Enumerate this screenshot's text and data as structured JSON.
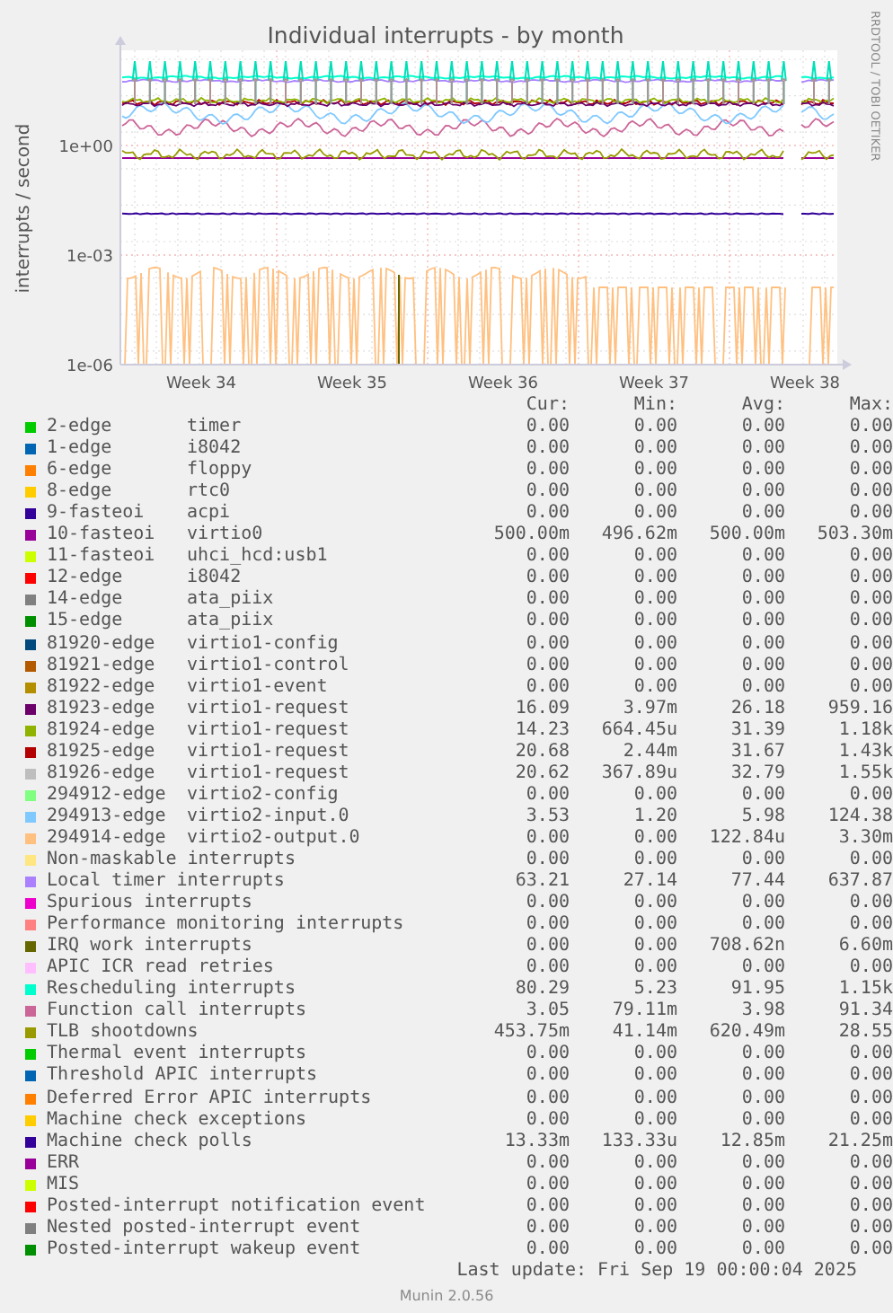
{
  "chart": {
    "title": "Individual interrupts - by month",
    "ylabel": "interrupts / second",
    "yticks": [
      "1e+00",
      "1e-03",
      "1e-06"
    ],
    "xticks": [
      "Week 34",
      "Week 35",
      "Week 36",
      "Week 37",
      "Week 38"
    ],
    "credit": "RRDTOOL / TOBI OETIKER"
  },
  "legend": {
    "columns": [
      "Cur:",
      "Min:",
      "Avg:",
      "Max:"
    ],
    "rows": [
      {
        "name": "2-edge",
        "label": "timer",
        "color": "#00cc00",
        "values": [
          "0.00",
          "0.00",
          "0.00",
          "0.00"
        ]
      },
      {
        "name": "1-edge",
        "label": "i8042",
        "color": "#0066b3",
        "values": [
          "0.00",
          "0.00",
          "0.00",
          "0.00"
        ]
      },
      {
        "name": "6-edge",
        "label": "floppy",
        "color": "#ff8000",
        "values": [
          "0.00",
          "0.00",
          "0.00",
          "0.00"
        ]
      },
      {
        "name": "8-edge",
        "label": "rtc0",
        "color": "#ffcc00",
        "values": [
          "0.00",
          "0.00",
          "0.00",
          "0.00"
        ]
      },
      {
        "name": "9-fasteoi",
        "label": "acpi",
        "color": "#330099",
        "values": [
          "0.00",
          "0.00",
          "0.00",
          "0.00"
        ]
      },
      {
        "name": "10-fasteoi",
        "label": "virtio0",
        "color": "#990099",
        "values": [
          "500.00m",
          "496.62m",
          "500.00m",
          "503.30m"
        ]
      },
      {
        "name": "11-fasteoi",
        "label": "uhci_hcd:usb1",
        "color": "#ccff00",
        "values": [
          "0.00",
          "0.00",
          "0.00",
          "0.00"
        ]
      },
      {
        "name": "12-edge",
        "label": "i8042",
        "color": "#ff0000",
        "values": [
          "0.00",
          "0.00",
          "0.00",
          "0.00"
        ]
      },
      {
        "name": "14-edge",
        "label": "ata_piix",
        "color": "#808080",
        "values": [
          "0.00",
          "0.00",
          "0.00",
          "0.00"
        ]
      },
      {
        "name": "15-edge",
        "label": "ata_piix",
        "color": "#008f00",
        "values": [
          "0.00",
          "0.00",
          "0.00",
          "0.00"
        ]
      },
      {
        "name": "81920-edge",
        "label": "virtio1-config",
        "color": "#00487d",
        "values": [
          "0.00",
          "0.00",
          "0.00",
          "0.00"
        ]
      },
      {
        "name": "81921-edge",
        "label": "virtio1-control",
        "color": "#b35a00",
        "values": [
          "0.00",
          "0.00",
          "0.00",
          "0.00"
        ]
      },
      {
        "name": "81922-edge",
        "label": "virtio1-event",
        "color": "#b38f00",
        "values": [
          "0.00",
          "0.00",
          "0.00",
          "0.00"
        ]
      },
      {
        "name": "81923-edge",
        "label": "virtio1-request",
        "color": "#6b006b",
        "values": [
          "16.09",
          "3.97m",
          "26.18",
          "959.16"
        ]
      },
      {
        "name": "81924-edge",
        "label": "virtio1-request",
        "color": "#8fb300",
        "values": [
          "14.23",
          "664.45u",
          "31.39",
          "1.18k"
        ]
      },
      {
        "name": "81925-edge",
        "label": "virtio1-request",
        "color": "#b30000",
        "values": [
          "20.68",
          "2.44m",
          "31.67",
          "1.43k"
        ]
      },
      {
        "name": "81926-edge",
        "label": "virtio1-request",
        "color": "#bebebe",
        "values": [
          "20.62",
          "367.89u",
          "32.79",
          "1.55k"
        ]
      },
      {
        "name": "294912-edge",
        "label": "virtio2-config",
        "color": "#80ff80",
        "values": [
          "0.00",
          "0.00",
          "0.00",
          "0.00"
        ]
      },
      {
        "name": "294913-edge",
        "label": "virtio2-input.0",
        "color": "#80c9ff",
        "values": [
          "3.53",
          "1.20",
          "5.98",
          "124.38"
        ]
      },
      {
        "name": "294914-edge",
        "label": "virtio2-output.0",
        "color": "#ffc080",
        "values": [
          "0.00",
          "0.00",
          "122.84u",
          "3.30m"
        ]
      },
      {
        "name": "Non-maskable interrupts",
        "color": "#ffe680",
        "values": [
          "0.00",
          "0.00",
          "0.00",
          "0.00"
        ]
      },
      {
        "name": "Local timer interrupts",
        "color": "#aa80ff",
        "values": [
          "63.21",
          "27.14",
          "77.44",
          "637.87"
        ]
      },
      {
        "name": "Spurious interrupts",
        "color": "#ee00cc",
        "values": [
          "0.00",
          "0.00",
          "0.00",
          "0.00"
        ]
      },
      {
        "name": "Performance monitoring interrupts",
        "color": "#ff8080",
        "values": [
          "0.00",
          "0.00",
          "0.00",
          "0.00"
        ]
      },
      {
        "name": "IRQ work interrupts",
        "color": "#666600",
        "values": [
          "0.00",
          "0.00",
          "708.62n",
          "6.60m"
        ]
      },
      {
        "name": "APIC ICR read retries",
        "color": "#ffbfff",
        "values": [
          "0.00",
          "0.00",
          "0.00",
          "0.00"
        ]
      },
      {
        "name": "Rescheduling interrupts",
        "color": "#00ffcc",
        "values": [
          "80.29",
          "5.23",
          "91.95",
          "1.15k"
        ]
      },
      {
        "name": "Function call interrupts",
        "color": "#cc6699",
        "values": [
          "3.05",
          "79.11m",
          "3.98",
          "91.34"
        ]
      },
      {
        "name": "TLB shootdowns",
        "color": "#999900",
        "values": [
          "453.75m",
          "41.14m",
          "620.49m",
          "28.55"
        ]
      },
      {
        "name": "Thermal event interrupts",
        "color": "#00cc00",
        "values": [
          "0.00",
          "0.00",
          "0.00",
          "0.00"
        ]
      },
      {
        "name": "Threshold APIC interrupts",
        "color": "#0066b3",
        "values": [
          "0.00",
          "0.00",
          "0.00",
          "0.00"
        ]
      },
      {
        "name": "Deferred Error APIC interrupts",
        "color": "#ff8000",
        "values": [
          "0.00",
          "0.00",
          "0.00",
          "0.00"
        ]
      },
      {
        "name": "Machine check exceptions",
        "color": "#ffcc00",
        "values": [
          "0.00",
          "0.00",
          "0.00",
          "0.00"
        ]
      },
      {
        "name": "Machine check polls",
        "color": "#330099",
        "values": [
          "13.33m",
          "133.33u",
          "12.85m",
          "21.25m"
        ]
      },
      {
        "name": "ERR",
        "color": "#990099",
        "values": [
          "0.00",
          "0.00",
          "0.00",
          "0.00"
        ]
      },
      {
        "name": "MIS",
        "color": "#ccff00",
        "values": [
          "0.00",
          "0.00",
          "0.00",
          "0.00"
        ]
      },
      {
        "name": "Posted-interrupt notification event",
        "color": "#ff0000",
        "values": [
          "0.00",
          "0.00",
          "0.00",
          "0.00"
        ]
      },
      {
        "name": "Nested posted-interrupt event",
        "color": "#808080",
        "values": [
          "0.00",
          "0.00",
          "0.00",
          "0.00"
        ]
      },
      {
        "name": "Posted-interrupt wakeup event",
        "color": "#008f00",
        "values": [
          "0.00",
          "0.00",
          "0.00",
          "0.00"
        ]
      }
    ]
  },
  "last_update": "Last update: Fri Sep 19 00:00:04 2025",
  "footer": "Munin 2.0.56"
}
